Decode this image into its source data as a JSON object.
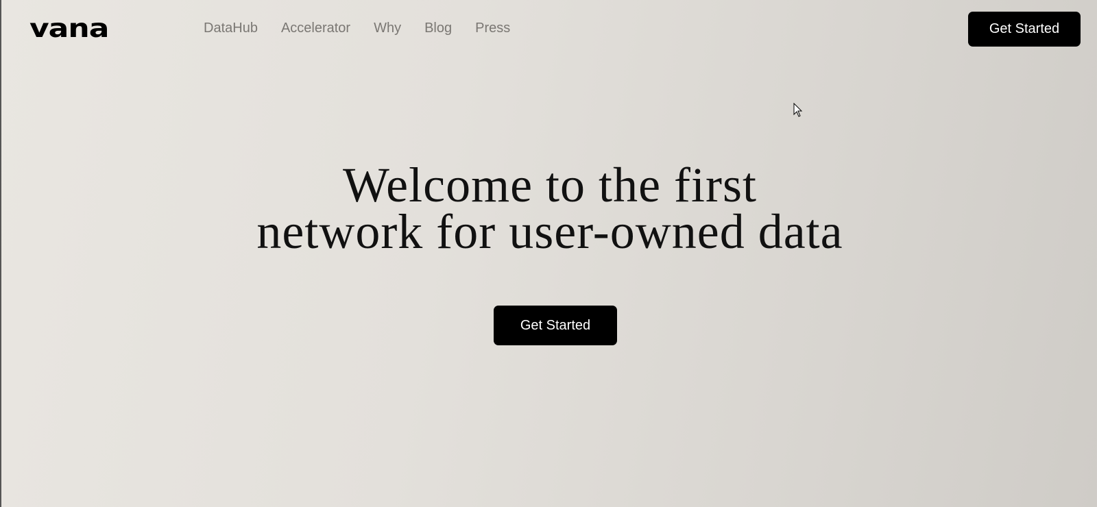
{
  "header": {
    "logo": "vana",
    "nav": [
      "DataHub",
      "Accelerator",
      "Why",
      "Blog",
      "Press"
    ],
    "cta_label": "Get Started"
  },
  "hero": {
    "line1": "Welcome to the first",
    "line2": "network for user-owned data",
    "cta_label": "Get Started"
  }
}
